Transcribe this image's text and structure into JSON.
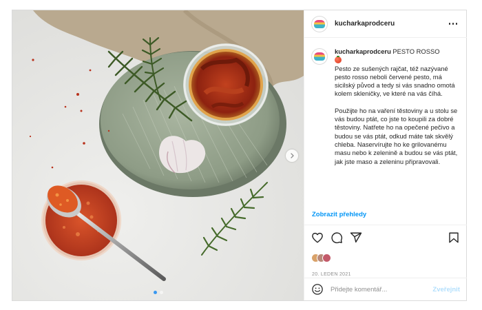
{
  "post": {
    "username": "kucharkaprodceru",
    "header_icons": {
      "avatar": "avatar",
      "more": "more-icon"
    }
  },
  "caption": {
    "username": "kucharkaprodceru",
    "title": "PESTO ROSSO",
    "emoji": "tomato-emoji",
    "paragraph1": "Pesto ze sušených rajčat, též nazývané pesto rosso neboli červené pesto, má sicilský původ a tedy si vás snadno omotá kolem skleničky, ve které na vás číhá.",
    "paragraph2": "Použijte ho na vaření těstoviny a u stolu se vás budou ptát, co jste to koupili za dobré těstoviny. Natřete ho na opečené pečivo a budou se vás ptát, odkud máte tak skvělý chleba. Naservírujte ho ke grilovanému masu nebo k zelenině a budou se vás ptát, jak jste maso a zeleninu připravovali."
  },
  "translate_link": "Zobrazit přehledy",
  "actions": [
    "heart-icon",
    "comment-icon",
    "share-icon",
    "bookmark-icon"
  ],
  "date": "20. LEDEN 2021",
  "comment": {
    "placeholder": "Přidejte komentář...",
    "publish_label": "Zveřejnit"
  },
  "carousel": {
    "total": 2,
    "active": 1
  },
  "colors": {
    "link": "#0095f6",
    "publish_disabled": "#b2dffc",
    "carousel_active": "#3897f0",
    "muted": "#8e8e8e"
  }
}
